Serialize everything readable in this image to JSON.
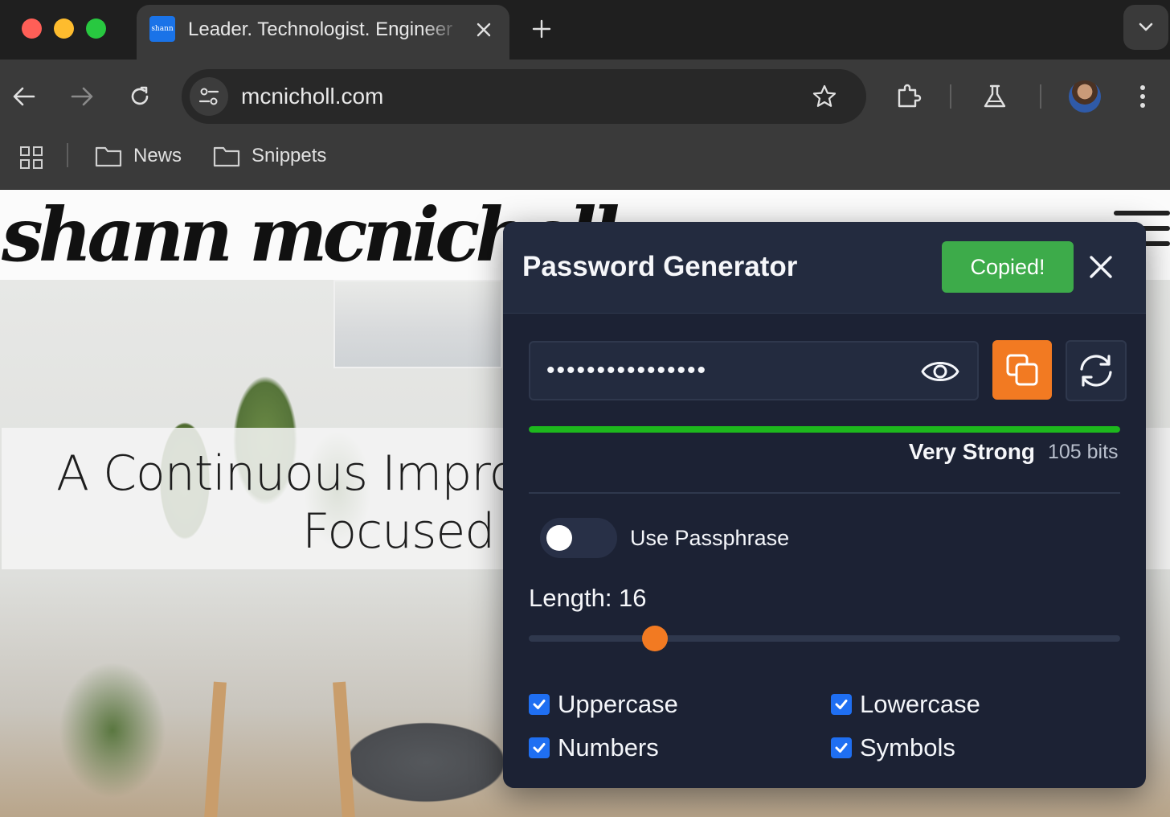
{
  "browser": {
    "tab": {
      "favicon_text": "shann",
      "title": "Leader. Technologist. Engineer"
    },
    "url": "mcnicholl.com",
    "bookmarks": [
      {
        "label": "News"
      },
      {
        "label": "Snippets"
      }
    ]
  },
  "site": {
    "logo": "shann mcnicholl_",
    "hero_line1": "A Continuous Improve",
    "hero_line2": "Focused T"
  },
  "password_generator": {
    "title": "Password Generator",
    "copied_label": "Copied!",
    "password_masked": "••••••••••••••••",
    "strength": {
      "label": "Very Strong",
      "bits": "105 bits",
      "fraction": 1.0,
      "color": "#1db81d"
    },
    "passphrase": {
      "label": "Use Passphrase",
      "enabled": false
    },
    "length": {
      "label": "Length: 16",
      "value": 16,
      "min": 4,
      "max": 64
    },
    "options": [
      {
        "label": "Uppercase",
        "checked": true
      },
      {
        "label": "Lowercase",
        "checked": true
      },
      {
        "label": "Numbers",
        "checked": true
      },
      {
        "label": "Symbols",
        "checked": true
      }
    ],
    "colors": {
      "accent": "#f27a22",
      "success": "#3dab4a",
      "panel": "#1c2234",
      "checkbox": "#1f6ff2"
    }
  }
}
